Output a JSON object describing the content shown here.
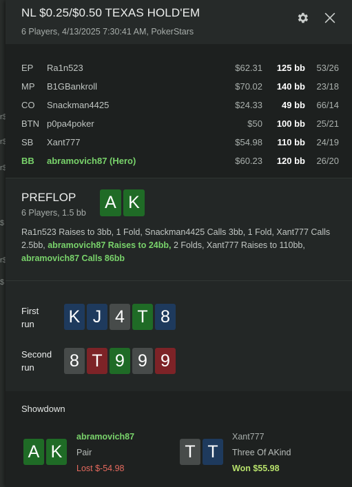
{
  "header": {
    "title": "NL $0.25/$0.50 TEXAS HOLD'EM",
    "subtitle": "6 Players, 4/13/2025 7:30:41 AM, PokerStars"
  },
  "background_marks": [
    "r$",
    "r$",
    "r$",
    "$",
    "r$",
    "$"
  ],
  "players": [
    {
      "pos": "EP",
      "name": "Ra1n523",
      "stack": "$62.31",
      "bb": "125 bb",
      "stat": "53/26"
    },
    {
      "pos": "MP",
      "name": "B1GBankroll",
      "stack": "$70.02",
      "bb": "140 bb",
      "stat": "23/18"
    },
    {
      "pos": "CO",
      "name": "Snackman4425",
      "stack": "$24.33",
      "bb": "49 bb",
      "stat": "66/14"
    },
    {
      "pos": "BTN",
      "name": "p0pa4poker",
      "stack": "$50",
      "bb": "100 bb",
      "stat": "25/21"
    },
    {
      "pos": "SB",
      "name": "Xant777",
      "stack": "$54.98",
      "bb": "110 bb",
      "stat": "24/19"
    },
    {
      "pos": "BB",
      "name": "abramovich87 (Hero)",
      "stack": "$60.23",
      "bb": "120 bb",
      "stat": "26/20"
    }
  ],
  "preflop": {
    "title": "PREFLOP",
    "subtitle": "6 Players, 1.5 bb",
    "hero_cards": [
      "A",
      "K"
    ],
    "action": {
      "p1": "Ra1n523 Raises to 3bb, 1 Fold, Snackman4425 Calls 3bb, 1 Fold, Xant777 Calls 2.5bb, ",
      "h1": "abramovich87 Raises to 24bb,",
      "p2": " 2 Folds, Xant777 Raises to 110bb, ",
      "h2": "abramovich87 Calls 86bb"
    }
  },
  "runs": [
    {
      "label_line1": "First",
      "label_line2": "run",
      "cards": [
        "K",
        "J",
        "4",
        "T",
        "8"
      ]
    },
    {
      "label_line1": "Second",
      "label_line2": "run",
      "cards": [
        "8",
        "T",
        "9",
        "9",
        "9"
      ]
    }
  ],
  "showdown": {
    "title": "Showdown",
    "players": [
      {
        "name": "abramovich87",
        "hand": "Pair",
        "result": "Lost $-54.98",
        "cards": [
          "A",
          "K"
        ]
      },
      {
        "name": "Xant777",
        "hand": "Three Of AKind",
        "result": "Won $55.98",
        "cards": [
          "T",
          "T"
        ]
      }
    ]
  },
  "colors": {
    "hero_green": "#79d36b",
    "card_green": "#1f6b26",
    "card_blue": "#1e3a5d",
    "card_grey": "#474b4a",
    "card_red": "#7d2327",
    "lost_red": "#e56a5e",
    "won_green": "#b6e06b"
  },
  "icons": [
    "settings-gear-icon",
    "close-icon"
  ]
}
